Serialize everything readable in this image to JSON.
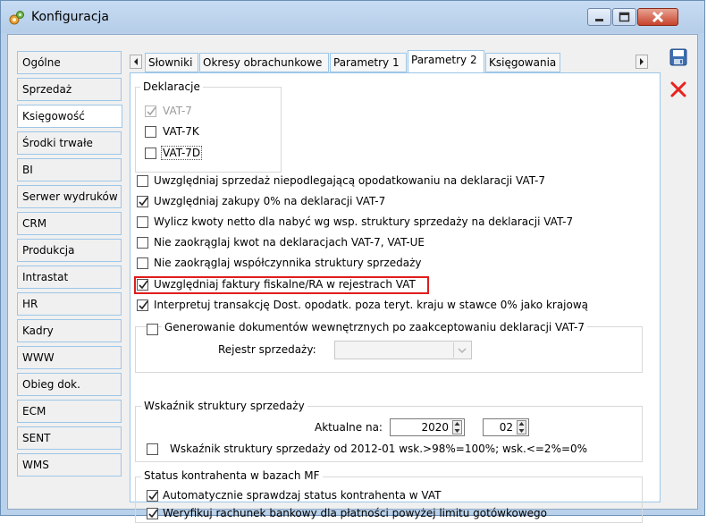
{
  "window": {
    "title": "Konfiguracja"
  },
  "nav": {
    "items": [
      {
        "label": "Ogólne"
      },
      {
        "label": "Sprzedaż"
      },
      {
        "label": "Księgowość",
        "active": true
      },
      {
        "label": "Środki trwałe"
      },
      {
        "label": "BI"
      },
      {
        "label": "Serwer wydruków"
      },
      {
        "label": "CRM"
      },
      {
        "label": "Produkcja"
      },
      {
        "label": "Intrastat"
      },
      {
        "label": "HR"
      },
      {
        "label": "Kadry"
      },
      {
        "label": "WWW"
      },
      {
        "label": "Obieg dok."
      },
      {
        "label": "ECM"
      },
      {
        "label": "SENT"
      },
      {
        "label": "WMS"
      }
    ]
  },
  "tabs": {
    "items": [
      {
        "label": "Słowniki"
      },
      {
        "label": "Okresy obrachunkowe"
      },
      {
        "label": "Parametry 1"
      },
      {
        "label": "Parametry 2",
        "active": true
      },
      {
        "label": "Księgowania"
      }
    ]
  },
  "deklaracje": {
    "title": "Deklaracje",
    "items": [
      {
        "label": "VAT-7",
        "checked": true,
        "disabled": true
      },
      {
        "label": "VAT-7K",
        "checked": false
      },
      {
        "label": "VAT-7D",
        "checked": false
      }
    ]
  },
  "options": {
    "items": [
      {
        "label": "Uwzględniaj sprzedaż niepodlegającą opodatkowaniu na deklaracji VAT-7",
        "checked": false
      },
      {
        "label": "Uwzględniaj zakupy 0% na deklaracji VAT-7",
        "checked": true
      },
      {
        "label": "Wylicz kwoty netto dla nabyć wg wsp. struktury sprzedaży na deklaracji VAT-7",
        "checked": false
      },
      {
        "label": "Nie zaokrąglaj kwot na deklaracjach VAT-7, VAT-UE",
        "checked": false
      },
      {
        "label": "Nie zaokrąglaj współczynnika struktury sprzedaży",
        "checked": false
      },
      {
        "label": "Uwzględniaj faktury fiskalne/RA w rejestrach VAT",
        "checked": true,
        "highlighted": true
      },
      {
        "label": "Interpretuj transakcję Dost. opodatk. poza teryt. kraju w stawce 0% jako krajową",
        "checked": true
      }
    ]
  },
  "generowanie": {
    "label": "Generowanie dokumentów wewnętrznych po zaakceptowaniu deklaracji VAT-7",
    "checked": false,
    "rejestr_label": "Rejestr sprzedaży:",
    "rejestr_value": ""
  },
  "wskaznik": {
    "title": "Wskaźnik struktury sprzedaży",
    "aktualne_label": "Aktualne na:",
    "year": "2020",
    "month": "02",
    "checkbox_label": "Wskaźnik struktury sprzedaży od 2012-01 wsk.>98%=100%; wsk.<=2%=0%",
    "checked": false
  },
  "status": {
    "title": "Status kontrahenta w bazach MF",
    "items": [
      {
        "label": "Automatycznie sprawdzaj status kontrahenta w VAT",
        "checked": true
      },
      {
        "label": "Weryfikuj rachunek bankowy dla płatności powyżej limitu gotówkowego",
        "checked": true
      }
    ]
  },
  "actions": {
    "save_icon": "save-icon",
    "close_icon": "close-icon"
  },
  "colors": {
    "highlight": "#e01d1d",
    "accent": "#9cc6e8"
  }
}
